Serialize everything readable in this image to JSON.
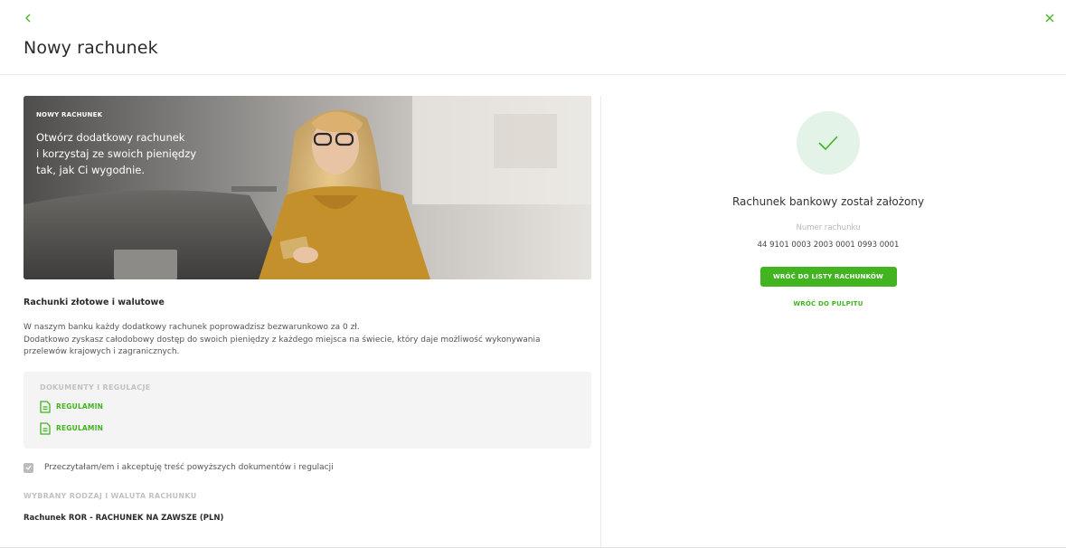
{
  "header": {
    "title": "Nowy rachunek",
    "back_icon": "chevron-left-icon",
    "close_icon": "close-icon"
  },
  "banner": {
    "eyebrow": "NOWY RACHUNEK",
    "lines": [
      "Otwórz dodatkowy rachunek",
      "i korzystaj ze swoich pieniędzy",
      "tak, jak Ci wygodnie."
    ]
  },
  "info": {
    "heading": "Rachunki złotowe i walutowe",
    "lines": [
      "W naszym banku każdy dodatkowy rachunek poprowadzisz bezwarunkowo za 0 zł.",
      "Dodatkowo zyskasz całodobowy dostęp do swoich pieniędzy z każdego miejsca na świecie, który daje możliwość wykonywania",
      "przelewów krajowych i zagranicznych."
    ]
  },
  "documents": {
    "label": "DOKUMENTY I REGULACJE",
    "items": [
      {
        "label": "REGULAMIN",
        "icon": "document-icon"
      },
      {
        "label": "REGULAMIN",
        "icon": "document-icon"
      }
    ]
  },
  "consent": {
    "checked": true,
    "text": "Przeczytałam/em i akceptuję treść powyższych dokumentów i regulacji"
  },
  "selection": {
    "label": "WYBRANY RODZAJ I WALUTA RACHUNKU",
    "value": "Rachunek ROR - RACHUNEK NA ZAWSZE (PLN)"
  },
  "success": {
    "icon": "checkmark-icon",
    "title": "Rachunek bankowy został założony",
    "account_label": "Numer rachunku",
    "account_number": "44 9101 0003 2003 0001 0993 0001",
    "primary_button": "WRÓĆ DO LISTY RACHUNKÓW",
    "secondary_link": "WRÓĆ DO PULPITU"
  },
  "colors": {
    "accent": "#41b41f",
    "success_bg": "#e3f3e7",
    "muted": "#c2c2c2"
  }
}
